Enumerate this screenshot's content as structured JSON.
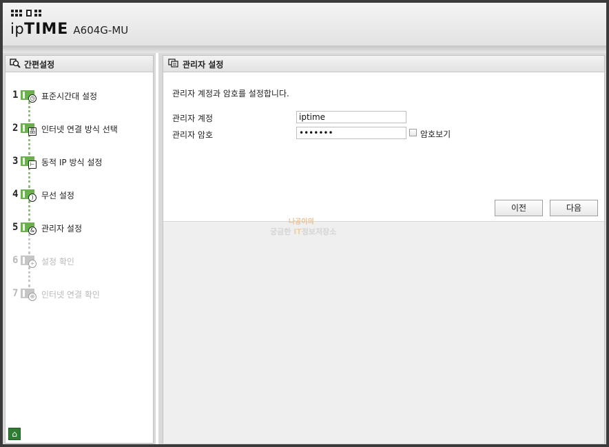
{
  "header": {
    "logo_ip": "ip",
    "logo_time": "TIME",
    "model": "A604G-MU"
  },
  "sidebar": {
    "title": "간편설정",
    "steps": [
      {
        "num": "1",
        "label": "표준시간대 설정",
        "icon": "clock-icon",
        "active": true
      },
      {
        "num": "2",
        "label": "인터넷 연결 방식 선택",
        "icon": "network-icon",
        "active": true
      },
      {
        "num": "3",
        "label": "동적 IP 방식 설정",
        "icon": "ip-tree-icon",
        "active": true
      },
      {
        "num": "4",
        "label": "무선 설정",
        "icon": "wifi-icon",
        "active": true
      },
      {
        "num": "5",
        "label": "관리자 설정",
        "icon": "admin-icon",
        "active": true
      },
      {
        "num": "6",
        "label": "설정 확인",
        "icon": "check-icon",
        "active": false
      },
      {
        "num": "7",
        "label": "인터넷 연결 확인",
        "icon": "globe-icon",
        "active": false
      }
    ],
    "home_icon": "home-icon"
  },
  "main": {
    "title": "관리자 설정",
    "description": "관리자 계정과 암호를 설정합니다.",
    "account_label": "관리자 계정",
    "account_value": "iptime",
    "password_label": "관리자 암호",
    "password_value": "•••••••",
    "show_password_label": "암호보기",
    "prev_button": "이전",
    "next_button": "다음"
  },
  "watermark": {
    "line1": "나공이의",
    "line2a": "궁금한 ",
    "line2b": "IT",
    "line2c": "정보저장소"
  },
  "colors": {
    "step_active": "#6ab04c",
    "step_inactive": "#c6c6c6",
    "home_button": "#2f7d32"
  }
}
